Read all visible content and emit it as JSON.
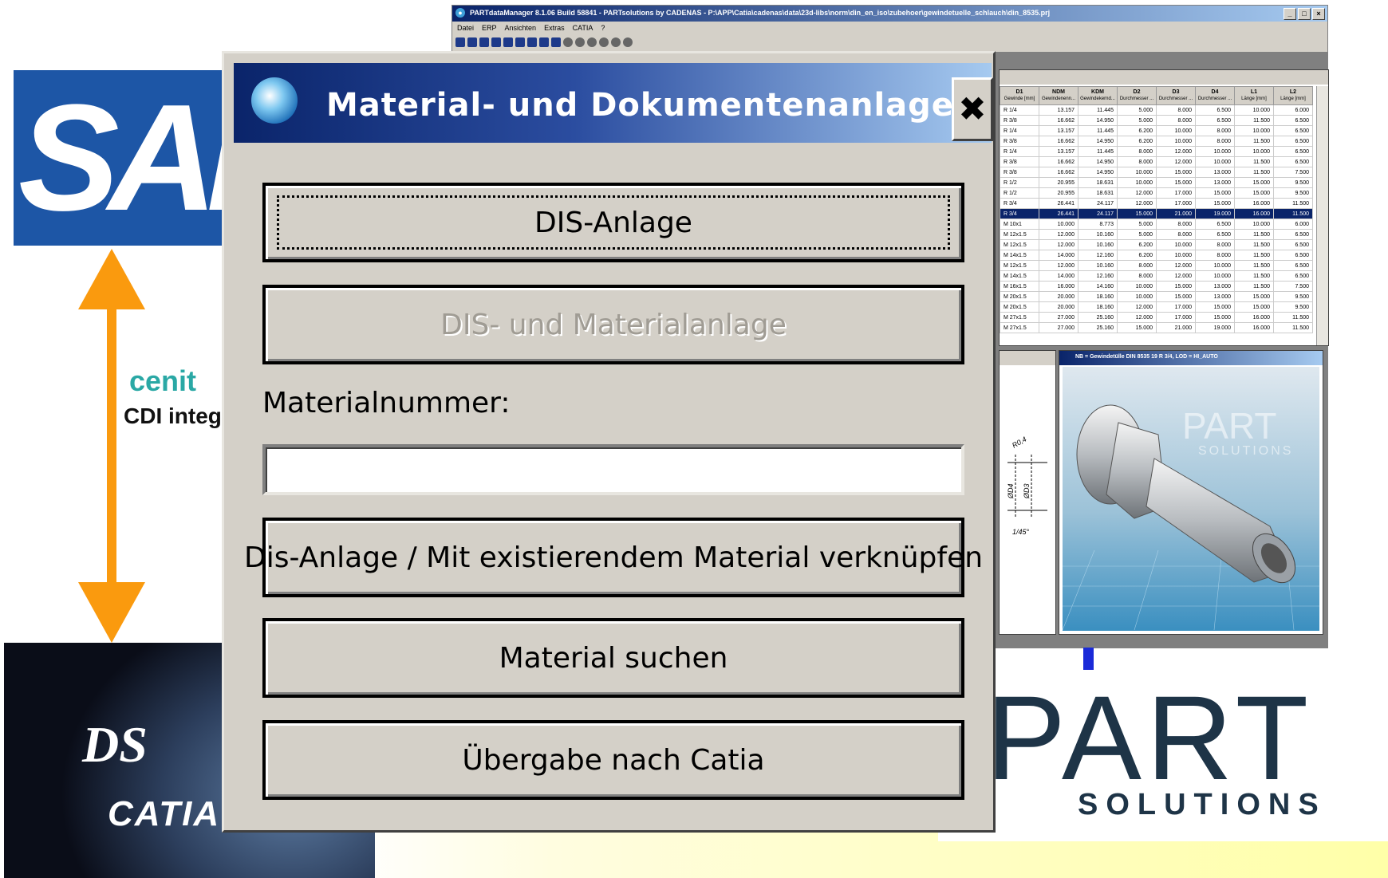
{
  "slide": {
    "sap_logo_text": "SAP",
    "cenit_text": "cenit",
    "cdi_text": "CDI integration",
    "catia_ds": "DS",
    "catia_word": "CATIA",
    "part_logo_text": "PART",
    "part_logo_sub": "SOLUTIONS"
  },
  "pdm_window": {
    "title": "PARTdataManager 8.1.06 Build 58841 - PARTsolutions by CADENAS - P:\\APP\\Catia\\cadenas\\data\\23d-libs\\norm\\din_en_iso\\zubehoer\\gewindetuelle_schlauch\\din_8535.prj",
    "menu": [
      "Datei",
      "ERP",
      "Ansichten",
      "Extras",
      "CATIA",
      "?"
    ],
    "table": {
      "columns": [
        {
          "name": "D1",
          "sub": "Gewinde [mm]"
        },
        {
          "name": "NDM",
          "sub": "Gewindenenn..."
        },
        {
          "name": "KDM",
          "sub": "Gewindekernd..."
        },
        {
          "name": "D2",
          "sub": "Durchmesser ..."
        },
        {
          "name": "D3",
          "sub": "Durchmesser ..."
        },
        {
          "name": "D4",
          "sub": "Durchmesser ..."
        },
        {
          "name": "L1",
          "sub": "Länge [mm]"
        },
        {
          "name": "L2",
          "sub": "Länge [mm]"
        }
      ],
      "rows": [
        [
          "R 1/4",
          "13.157",
          "11.445",
          "5.000",
          "8.000",
          "6.500",
          "10.000",
          "6.000"
        ],
        [
          "R 3/8",
          "16.662",
          "14.950",
          "5.000",
          "8.000",
          "6.500",
          "11.500",
          "6.500"
        ],
        [
          "R 1/4",
          "13.157",
          "11.445",
          "6.200",
          "10.000",
          "8.000",
          "10.000",
          "6.500"
        ],
        [
          "R 3/8",
          "16.662",
          "14.950",
          "6.200",
          "10.000",
          "8.000",
          "11.500",
          "6.500"
        ],
        [
          "R 1/4",
          "13.157",
          "11.445",
          "8.000",
          "12.000",
          "10.000",
          "10.000",
          "6.500"
        ],
        [
          "R 3/8",
          "16.662",
          "14.950",
          "8.000",
          "12.000",
          "10.000",
          "11.500",
          "6.500"
        ],
        [
          "R 3/8",
          "16.662",
          "14.950",
          "10.000",
          "15.000",
          "13.000",
          "11.500",
          "7.500"
        ],
        [
          "R 1/2",
          "20.955",
          "18.631",
          "10.000",
          "15.000",
          "13.000",
          "15.000",
          "9.500"
        ],
        [
          "R 1/2",
          "20.955",
          "18.631",
          "12.000",
          "17.000",
          "15.000",
          "15.000",
          "9.500"
        ],
        [
          "R 3/4",
          "26.441",
          "24.117",
          "12.000",
          "17.000",
          "15.000",
          "16.000",
          "11.500"
        ],
        [
          "R 3/4",
          "26.441",
          "24.117",
          "15.000",
          "21.000",
          "19.000",
          "16.000",
          "11.500"
        ],
        [
          "M 10x1",
          "10.000",
          "8.773",
          "5.000",
          "8.000",
          "6.500",
          "10.000",
          "6.000"
        ],
        [
          "M 12x1.5",
          "12.000",
          "10.160",
          "5.000",
          "8.000",
          "6.500",
          "11.500",
          "6.500"
        ],
        [
          "M 12x1.5",
          "12.000",
          "10.160",
          "6.200",
          "10.000",
          "8.000",
          "11.500",
          "6.500"
        ],
        [
          "M 14x1.5",
          "14.000",
          "12.160",
          "6.200",
          "10.000",
          "8.000",
          "11.500",
          "6.500"
        ],
        [
          "M 12x1.5",
          "12.000",
          "10.160",
          "8.000",
          "12.000",
          "10.000",
          "11.500",
          "6.500"
        ],
        [
          "M 14x1.5",
          "14.000",
          "12.160",
          "8.000",
          "12.000",
          "10.000",
          "11.500",
          "6.500"
        ],
        [
          "M 16x1.5",
          "16.000",
          "14.160",
          "10.000",
          "15.000",
          "13.000",
          "11.500",
          "7.500"
        ],
        [
          "M 20x1.5",
          "20.000",
          "18.160",
          "10.000",
          "15.000",
          "13.000",
          "15.000",
          "9.500"
        ],
        [
          "M 20x1.5",
          "20.000",
          "18.160",
          "12.000",
          "17.000",
          "15.000",
          "15.000",
          "9.500"
        ],
        [
          "M 27x1.5",
          "27.000",
          "25.160",
          "12.000",
          "17.000",
          "15.000",
          "16.000",
          "11.500"
        ],
        [
          "M 27x1.5",
          "27.000",
          "25.160",
          "15.000",
          "21.000",
          "19.000",
          "16.000",
          "11.500"
        ]
      ],
      "selected_row": 10
    },
    "view_title": "NB = Gewindetülle DIN 8535 19 R 3/4, LOD = HI_AUTO",
    "view_watermark": "PART",
    "view_watermark_sub": "SOLUTIONS",
    "drawing_labels": [
      "R0,4",
      "ØD4",
      "ØD3",
      "1/45°"
    ]
  },
  "dialog": {
    "title": "Material- und Dokumentenanlage",
    "close_symbol": "✖",
    "btn_dis_anlage": "DIS-Anlage",
    "btn_dis_material": "DIS- und Materialanlage",
    "material_label": "Materialnummer:",
    "material_value": "",
    "btn_link_existing": "Dis-Anlage / Mit existierendem Material verknüpfen",
    "btn_search": "Material suchen",
    "btn_transfer": "Übergabe nach Catia"
  },
  "colors": {
    "sap_blue": "#1d56a6",
    "arrow_orange": "#fa9a0e",
    "cenit_teal": "#2aa8a5",
    "titlebar_dark": "#0a246a",
    "titlebar_light": "#a6caf0"
  }
}
